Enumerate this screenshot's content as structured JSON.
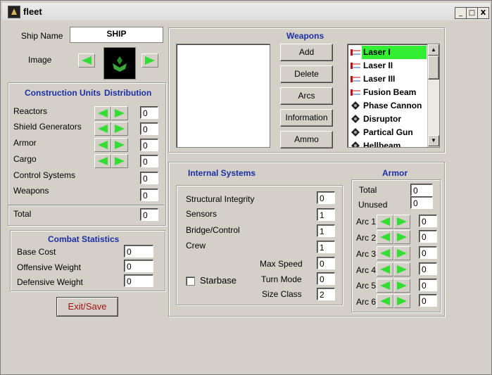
{
  "window": {
    "title": "fleet",
    "min": "_",
    "max": "□",
    "close": "X"
  },
  "ship": {
    "name_label": "Ship Name",
    "name_value": "SHIP",
    "image_label": "Image"
  },
  "construction": {
    "title": "Construction Units",
    "distribution": "Distribution",
    "rows": [
      {
        "label": "Reactors",
        "value": "0"
      },
      {
        "label": "Shield Generators",
        "value": "0"
      },
      {
        "label": "Armor",
        "value": "0"
      },
      {
        "label": "Cargo",
        "value": "0"
      },
      {
        "label": "Control Systems",
        "value": "0"
      },
      {
        "label": "Weapons",
        "value": "0"
      }
    ],
    "total_label": "Total",
    "total_value": "0"
  },
  "combat": {
    "title": "Combat Statistics",
    "rows": [
      {
        "label": "Base Cost",
        "value": "0"
      },
      {
        "label": "Offensive Weight",
        "value": "0"
      },
      {
        "label": "Defensive Weight",
        "value": "0"
      }
    ]
  },
  "exit_save": "Exit/Save",
  "weapons": {
    "title": "Weapons",
    "buttons": [
      "Add",
      "Delete",
      "Arcs",
      "Information",
      "Ammo"
    ],
    "list": [
      {
        "name": "Laser I",
        "icon": "beam-icon",
        "selected": true
      },
      {
        "name": "Laser II",
        "icon": "beam-icon"
      },
      {
        "name": "Laser III",
        "icon": "beam-icon"
      },
      {
        "name": "Fusion Beam",
        "icon": "beam-icon"
      },
      {
        "name": "Phase Cannon",
        "icon": "cannon-icon"
      },
      {
        "name": "Disruptor",
        "icon": "cannon-icon"
      },
      {
        "name": "Partical Gun",
        "icon": "cannon-icon"
      },
      {
        "name": "Hellbeam",
        "icon": "cannon-icon"
      }
    ]
  },
  "internal": {
    "title": "Internal Systems",
    "rows": [
      {
        "label": "Structural Integrity",
        "value": "0"
      },
      {
        "label": "Sensors",
        "value": "1"
      },
      {
        "label": "Bridge/Control",
        "value": "1"
      },
      {
        "label": "Crew",
        "value": "1"
      }
    ],
    "max_speed_label": "Max Speed",
    "max_speed": "0",
    "turn_mode_label": "Turn Mode",
    "turn_mode": "0",
    "size_class_label": "Size Class",
    "size_class": "2",
    "starbase_label": "Starbase"
  },
  "armor": {
    "title": "Armor",
    "total_label": "Total",
    "total_value": "0",
    "unused_label": "Unused",
    "unused_value": "0",
    "arcs": [
      {
        "label": "Arc 1",
        "value": "0"
      },
      {
        "label": "Arc 2",
        "value": "0"
      },
      {
        "label": "Arc 3",
        "value": "0"
      },
      {
        "label": "Arc 4",
        "value": "0"
      },
      {
        "label": "Arc 5",
        "value": "0"
      },
      {
        "label": "Arc 6",
        "value": "0"
      }
    ]
  },
  "colors": {
    "accent_blue": "#1a2fa8",
    "arrow_green": "#33dd33",
    "selected_green": "#33ee33",
    "exit_red": "#a01010"
  }
}
